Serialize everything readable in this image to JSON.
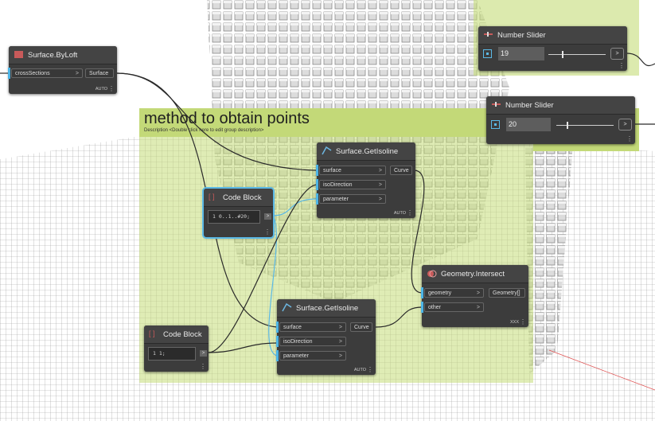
{
  "group": {
    "title": "method to obtain points",
    "description": "Description <Double click here to edit group description>"
  },
  "nodes": {
    "loft": {
      "title": "Surface.ByLoft",
      "input": "crossSections",
      "output": "Surface",
      "footer": "AUTO"
    },
    "slider1": {
      "title": "Number Slider",
      "value": "19"
    },
    "slider2": {
      "title": "Number Slider",
      "value": "20"
    },
    "isoline1": {
      "title": "Surface.GetIsoline",
      "inputs": [
        "surface",
        "isoDirection",
        "parameter"
      ],
      "output": "Curve",
      "footer": "AUTO"
    },
    "isoline2": {
      "title": "Surface.GetIsoline",
      "inputs": [
        "surface",
        "isoDirection",
        "parameter"
      ],
      "output": "Curve",
      "footer": "AUTO"
    },
    "code1": {
      "title": "Code Block",
      "line_no": "1",
      "code": "0..1..#20;"
    },
    "code2": {
      "title": "Code Block",
      "line_no": "1",
      "code": "1;"
    },
    "intersect": {
      "title": "Geometry.Intersect",
      "inputs": [
        "geometry",
        "other"
      ],
      "output": "Geometry[]",
      "footer": "XXX"
    }
  },
  "colors": {
    "wire": "#2a2a2a",
    "selected_wire": "#5bb9e6",
    "group_fill": "#c3d978",
    "node_bg": "#3c3c3c"
  }
}
